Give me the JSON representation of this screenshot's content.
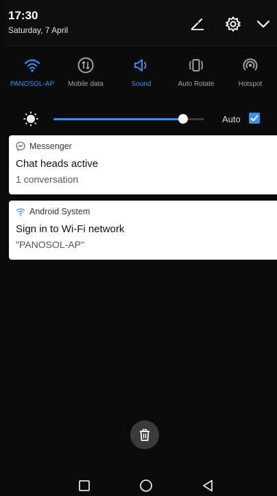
{
  "status": {
    "time": "17:30",
    "date": "Saturday, 7 April"
  },
  "header_icons": [
    "edit-icon",
    "gear-icon",
    "chevron-down-icon"
  ],
  "quick_settings": [
    {
      "label": "PANOSOL-AP",
      "icon": "wifi-icon",
      "active": true
    },
    {
      "label": "Mobile data",
      "icon": "mobile-data-icon",
      "active": false
    },
    {
      "label": "Sound",
      "icon": "sound-icon",
      "active": true
    },
    {
      "label": "Auto Rotate",
      "icon": "auto-rotate-icon",
      "active": false
    },
    {
      "label": "Hotspot",
      "icon": "hotspot-icon",
      "active": false
    }
  ],
  "brightness": {
    "level_percent": 86,
    "auto_label": "Auto",
    "auto_checked": true
  },
  "notifications": [
    {
      "app": "Messenger",
      "title": "Chat heads active",
      "text": "1 conversation",
      "icon": "messenger-icon"
    },
    {
      "app": "Android System",
      "title": "Sign in to Wi-Fi network",
      "text": "\"PANOSOL-AP\"",
      "icon": "wifi-signin-icon"
    }
  ],
  "colors": {
    "accent": "#3b8fe6",
    "background": "#0b0b0b",
    "card": "#ffffff",
    "inactive_label": "#a3a3a3"
  },
  "navigation": [
    "recents-icon",
    "home-icon",
    "back-icon"
  ]
}
